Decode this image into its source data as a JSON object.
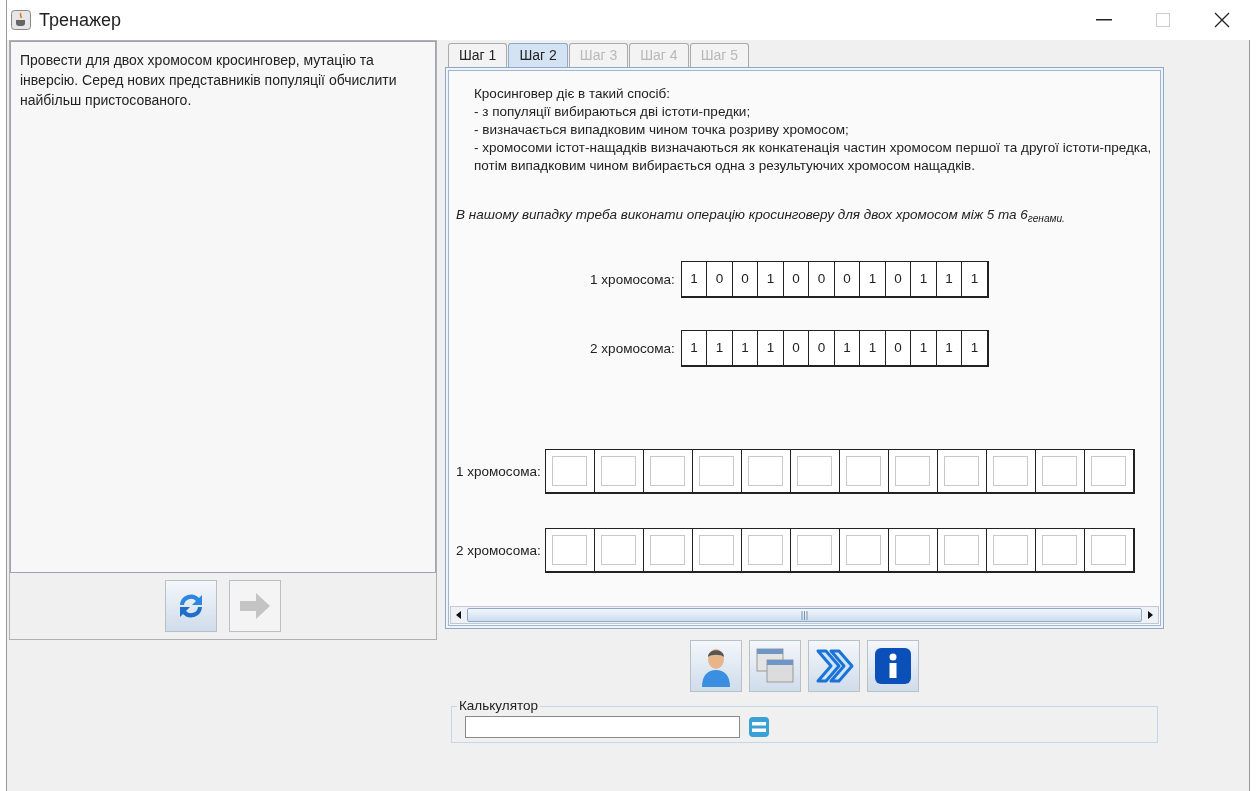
{
  "window": {
    "title": "Тренажер"
  },
  "task": {
    "text": "Провести для двох хромосом кросинговер, мутацію та інверсію. Серед нових представників популяції обчислити найбільш пристосованого."
  },
  "tabs": [
    {
      "label": "Шаг 1",
      "selected": false,
      "disabled": false
    },
    {
      "label": "Шаг 2",
      "selected": true,
      "disabled": false
    },
    {
      "label": "Шаг 3",
      "selected": false,
      "disabled": true
    },
    {
      "label": "Шаг 4",
      "selected": false,
      "disabled": true
    },
    {
      "label": "Шаг 5",
      "selected": false,
      "disabled": true
    }
  ],
  "explanation": {
    "lines": [
      "Кросинговер діє в такий спосіб:",
      "- з популяції вибираються дві істоти-предки;",
      "- визначається випадковим чином точка розриву хромосом;",
      "- хромосоми істот-нащадків визначаються як конкатенація частин хромосом першої та другої істоти-предка, потім випадковим чином вибирається одна з результуючих хромосом нащадків."
    ],
    "note": "В нашому випадку треба виконати операцію кросинговеру для двох хромосом між 5 та 6$_{генами.}$"
  },
  "parents": [
    {
      "label": "1 хромосома:",
      "genes": [
        "1",
        "0",
        "0",
        "1",
        "0",
        "0",
        "0",
        "1",
        "0",
        "1",
        "1",
        "1"
      ]
    },
    {
      "label": "2 хромосома:",
      "genes": [
        "1",
        "1",
        "1",
        "1",
        "0",
        "0",
        "1",
        "1",
        "0",
        "1",
        "1",
        "1"
      ]
    }
  ],
  "offspring": [
    {
      "label": "1 хромосома:"
    },
    {
      "label": "2 хромосома:"
    }
  ],
  "calculator": {
    "legend": "Калькулятор"
  }
}
